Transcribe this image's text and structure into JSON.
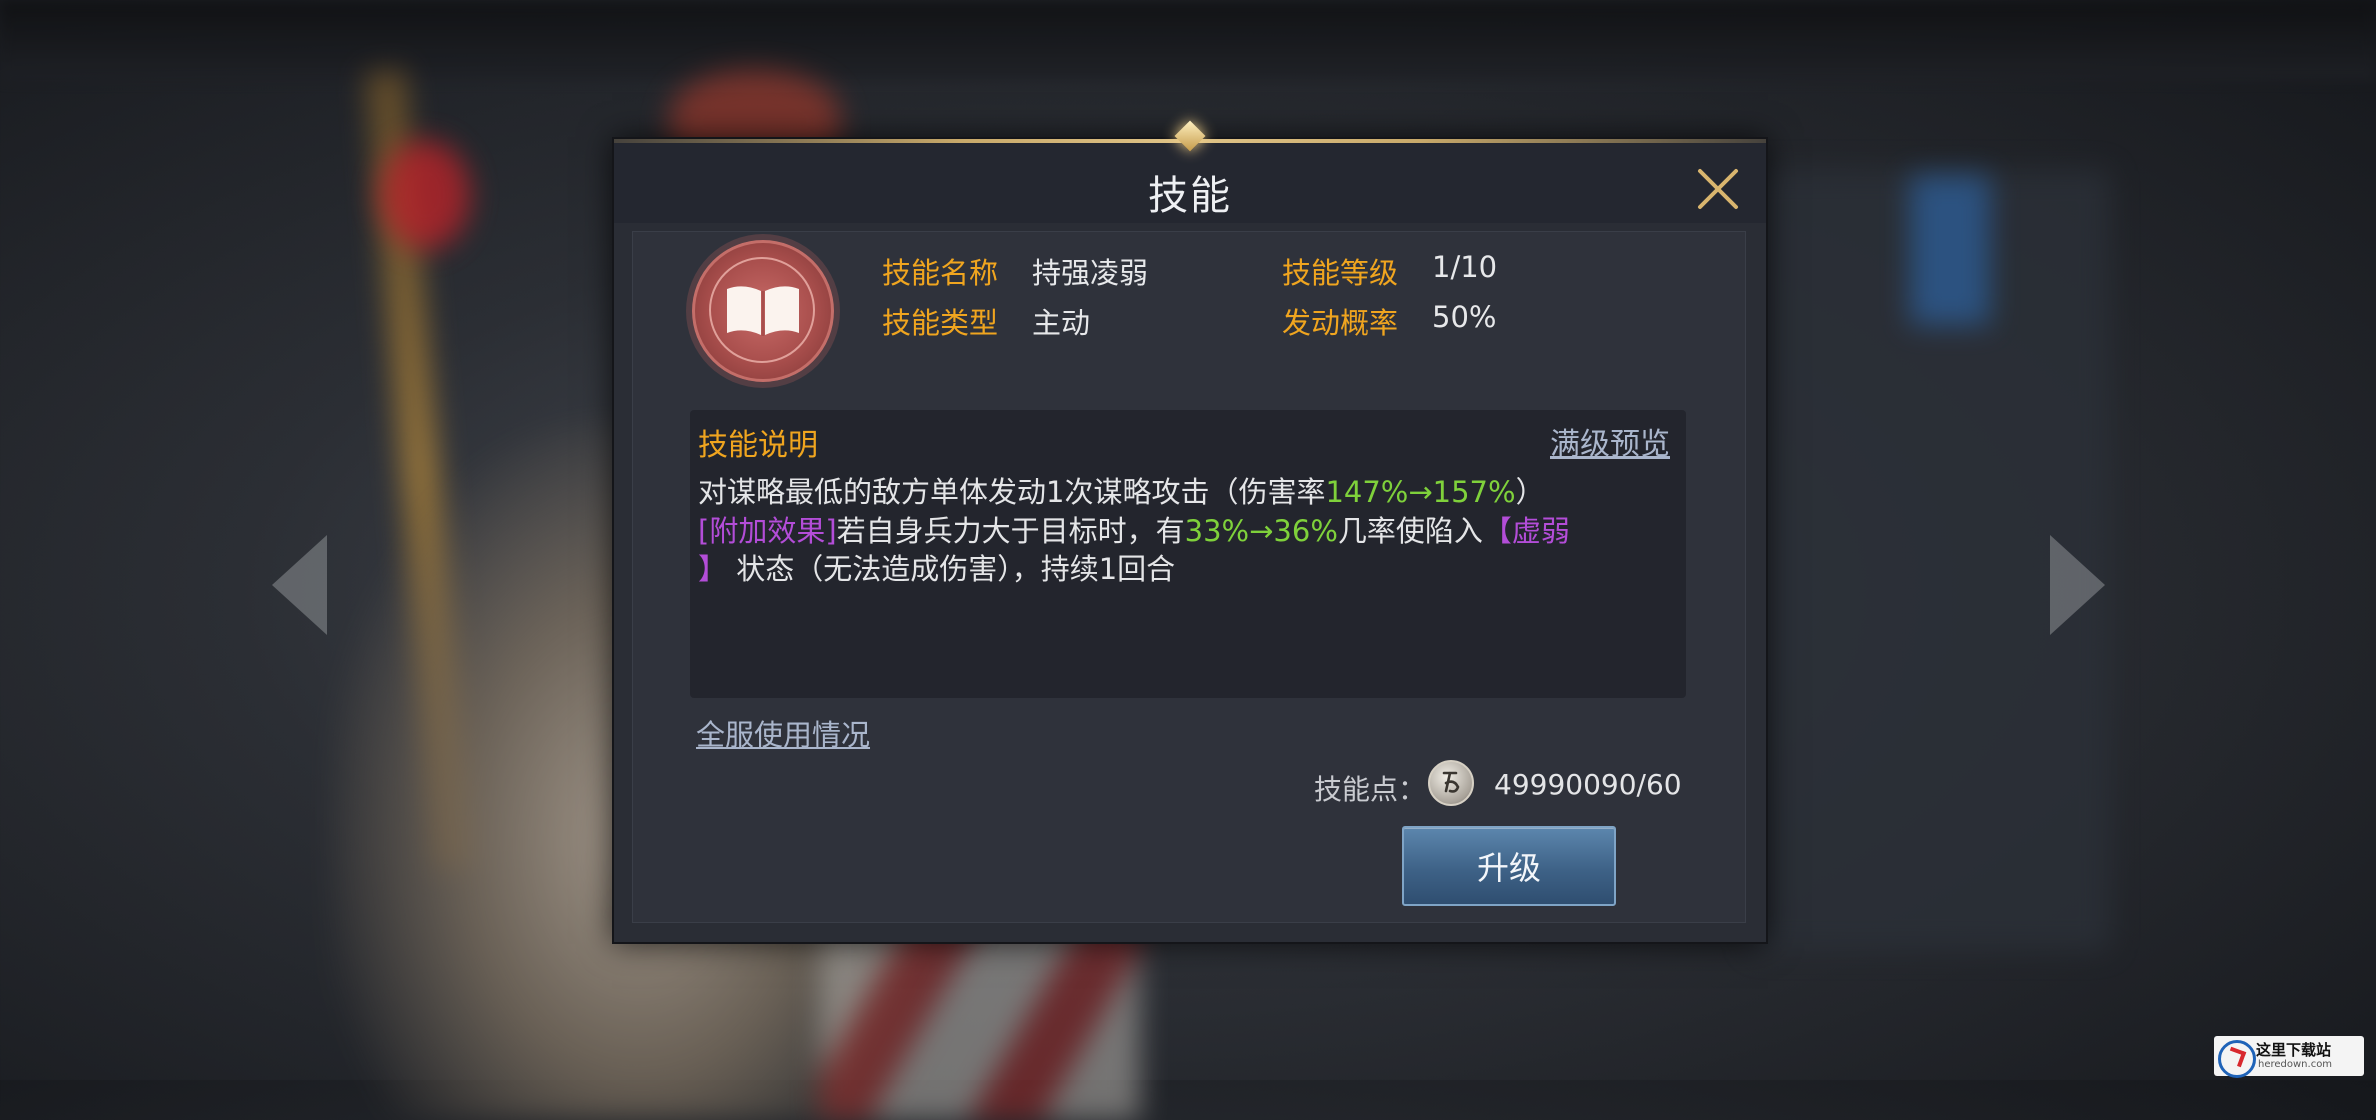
{
  "dialog": {
    "title": "技能",
    "skill": {
      "name_label": "技能名称",
      "name": "持强凌弱",
      "level_label": "技能等级",
      "level": "1/10",
      "type_label": "技能类型",
      "type": "主动",
      "chance_label": "发动概率",
      "chance": "50%"
    },
    "description": {
      "title": "技能说明",
      "preview_link": "满级预览",
      "line1_text": "对谋略最低的敌方单体发动1次谋略攻击（伤害率",
      "line1_highlight": "147%→157%",
      "line1_end": "）",
      "line2_tag": "[附加效果]",
      "line2_text": "若自身兵力大于目标时，有",
      "line2_highlight": "33%→36%",
      "line2_text2": "几率使陷入",
      "line2_status": "【虚弱",
      "line3_status_end": "】",
      "line3_text": "状态（无法造成伤害），持续1回合"
    },
    "usage_link": "全服使用情况",
    "skill_points_label": "技能点：",
    "skill_points_value": "49990090/60",
    "upgrade_button": "升级"
  },
  "icons": [
    "close-icon",
    "book-icon",
    "coin-icon",
    "arrow-left-icon",
    "arrow-right-icon"
  ],
  "colors": {
    "gold_label": "#f0a51f",
    "highlight_green": "#7fd13b",
    "status_purple": "#b34dd8",
    "button_blue": "#3e6287"
  },
  "watermark": {
    "title": "这里下载站",
    "url": "heredown.com"
  }
}
